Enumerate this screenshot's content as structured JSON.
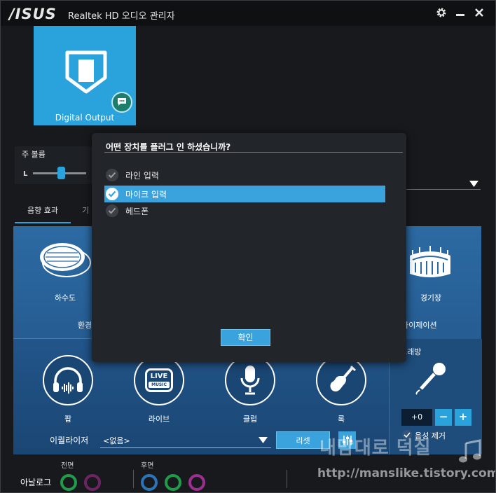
{
  "window": {
    "logo": "/ISUS",
    "title": "Realtek HD 오디오 관리자"
  },
  "device": {
    "label": "Digital Output"
  },
  "volume": {
    "label": "주 볼륨",
    "left_label": "L"
  },
  "tabs": [
    {
      "label": "음향 효과"
    },
    {
      "label": "기"
    }
  ],
  "environment": {
    "label": "환경",
    "items": [
      {
        "label": "하수도"
      },
      {
        "label": "경기장"
      }
    ],
    "simulation_label": "라이제이션"
  },
  "eq": {
    "items": [
      {
        "label": "팝"
      },
      {
        "label": "라이브"
      },
      {
        "label": "클럽"
      },
      {
        "label": "록"
      }
    ],
    "equalizer_label": "이퀄라이저",
    "select_value": "<없음>",
    "reset_label": "리셋",
    "live_icon_text": "LIVE",
    "music_icon_text": "MUSIC"
  },
  "karaoke": {
    "label": "노래방",
    "value": "+0",
    "minus": "−",
    "plus": "+",
    "voice_cancel_label": "음성 제거"
  },
  "connectors": {
    "analog_label": "아날로그",
    "front_label": "전면",
    "rear_label": "후면"
  },
  "dialog": {
    "title": "어떤 장치를 플러그 인 하셨습니까?",
    "options": [
      {
        "label": "라인 입력",
        "selected": false
      },
      {
        "label": "마이크 입력",
        "selected": true
      },
      {
        "label": "헤드폰",
        "selected": false
      }
    ],
    "ok_label": "확인"
  },
  "watermark": {
    "line1": "내맘대로 덕질",
    "line2": "http://manslike.tistory.com"
  },
  "colors": {
    "accent": "#2aa3dd",
    "panel": "#2c6aa3",
    "background": "#17191c",
    "jack_green": "#1f9b4a",
    "jack_pink": "#9c2f8f",
    "jack_blue": "#2b74b8"
  }
}
